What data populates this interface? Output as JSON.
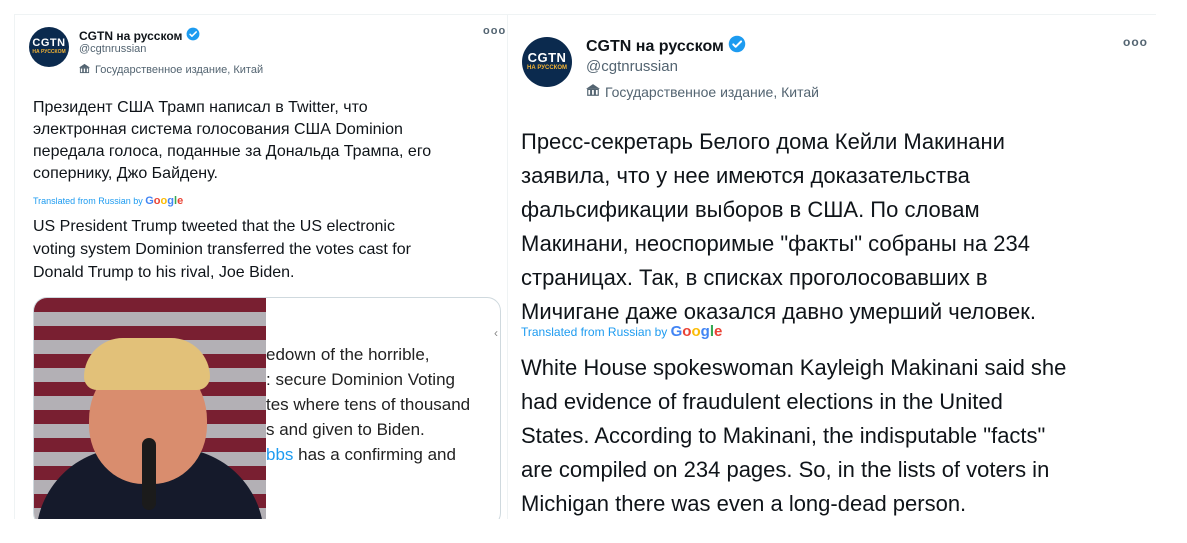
{
  "left_tweet": {
    "avatar": {
      "line1": "CGTN",
      "line2": "НА РУССКОМ"
    },
    "display_name": "CGTN на русском",
    "handle": "@cgtnrussian",
    "account_label": "Государственное издание, Китай",
    "text_original_lines": [
      "Президент США Трамп написал в Twitter, что",
      "электронная система голосования США Dominion",
      "передала голоса, поданные за Дональда Трампа, его",
      "сопернику, Джо Байдену."
    ],
    "translated_prefix": "Translated from Russian by",
    "text_translated_lines": [
      "US President Trump tweeted that the US electronic",
      "voting system Dominion transferred the votes cast for",
      "Donald Trump to his rival, Joe Biden."
    ],
    "media_text_lines": [
      "edown of the horrible,",
      ": secure Dominion Voting",
      "tes where tens of thousand",
      "s and given to Biden."
    ],
    "media_last_line": {
      "link": "bbs",
      "rest": " has a confirming and"
    }
  },
  "right_tweet": {
    "avatar": {
      "line1": "CGTN",
      "line2": "НА РУССКОМ"
    },
    "display_name": "CGTN на русском",
    "handle": "@cgtnrussian",
    "account_label": "Государственное издание, Китай",
    "text_original_lines": [
      "Пресс-секретарь Белого дома Кейли Макинани",
      "заявила, что у нее имеются доказательства",
      "фальсификации выборов в США. По словам",
      "Макинани, неоспоримые \"факты\" собраны на 234",
      "страницах. Так, в списках проголосовавших в",
      "Мичигане даже оказался давно умерший человек."
    ],
    "translated_prefix": "Translated from Russian by",
    "text_translated_lines": [
      "White House spokeswoman Kayleigh Makinani said she",
      "had evidence of fraudulent elections in the United",
      "States. According to Makinani, the indisputable \"facts\"",
      "are compiled on 234 pages. So, in the lists of voters in",
      "Michigan there was even a long-dead person."
    ]
  },
  "google_logo": [
    "G",
    "o",
    "o",
    "g",
    "l",
    "e"
  ],
  "colors": {
    "verified": "#1d9bf0",
    "link": "#1d9bf0",
    "avatar_bg": "#0b2a4e"
  },
  "icons": [
    "verified-badge-icon",
    "state-media-building-icon",
    "more-options-icon"
  ]
}
